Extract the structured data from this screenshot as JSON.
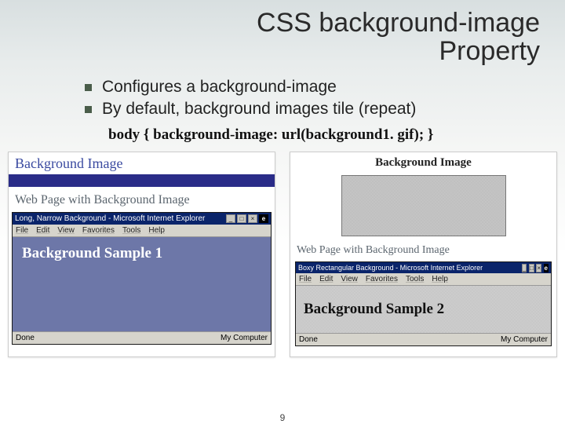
{
  "title_line1": "CSS background-image",
  "title_line2": "Property",
  "bullets": [
    "Configures a background-image",
    "By default, background images tile (repeat)"
  ],
  "code_sample": "body { background-image: url(background1. gif); }",
  "left_example": {
    "swatch_title": "Background Image",
    "subhead": "Web Page with Background Image",
    "window_title": "Long, Narrow Background - Microsoft Internet Explorer",
    "menus": [
      "File",
      "Edit",
      "View",
      "Favorites",
      "Tools",
      "Help"
    ],
    "content_heading": "Background Sample 1",
    "status_left": "Done",
    "status_right": "My Computer"
  },
  "right_example": {
    "swatch_title": "Background Image",
    "subhead": "Web Page with Background Image",
    "window_title": "Boxy Rectangular Background - Microsoft Internet Explorer",
    "menus": [
      "File",
      "Edit",
      "View",
      "Favorites",
      "Tools",
      "Help"
    ],
    "content_heading": "Background Sample 2",
    "status_left": "Done",
    "status_right": "My Computer"
  },
  "page_number": "9"
}
